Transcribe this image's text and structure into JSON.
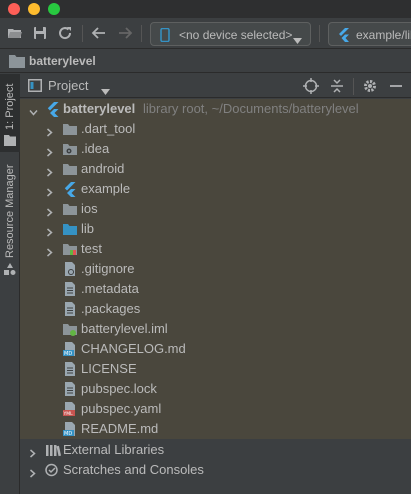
{
  "toolbar": {
    "device_selector": "<no device selected>",
    "config_selector": "example/lib"
  },
  "breadcrumb": {
    "label": "batterylevel"
  },
  "side_strip": {
    "project_tab": "1: Project",
    "resource_tab": "Resource Manager"
  },
  "panel": {
    "title": "Project"
  },
  "tree": {
    "root": {
      "name": "batterylevel",
      "hint": "library root, ~/Documents/batterylevel"
    },
    "items": [
      {
        "label": ".dart_tool",
        "icon": "folder-icon"
      },
      {
        "label": ".idea",
        "icon": "folder-settings-icon"
      },
      {
        "label": "android",
        "icon": "folder-icon"
      },
      {
        "label": "example",
        "icon": "flutter-icon"
      },
      {
        "label": "ios",
        "icon": "folder-icon"
      },
      {
        "label": "lib",
        "icon": "source-folder-icon"
      },
      {
        "label": "test",
        "icon": "test-folder-icon"
      },
      {
        "label": ".gitignore",
        "icon": "gitignore-file-icon"
      },
      {
        "label": ".metadata",
        "icon": "text-file-icon"
      },
      {
        "label": ".packages",
        "icon": "text-file-icon"
      },
      {
        "label": "batterylevel.iml",
        "icon": "iml-file-icon"
      },
      {
        "label": "CHANGELOG.md",
        "icon": "markdown-file-icon"
      },
      {
        "label": "LICENSE",
        "icon": "text-file-icon"
      },
      {
        "label": "pubspec.lock",
        "icon": "text-file-icon"
      },
      {
        "label": "pubspec.yaml",
        "icon": "yaml-file-icon"
      },
      {
        "label": "README.md",
        "icon": "markdown-file-icon"
      }
    ],
    "external_libraries": "External Libraries",
    "scratches": "Scratches and Consoles"
  },
  "colors": {
    "background": "#3c3f41",
    "tree_highlight": "#4a473d",
    "folder": "#8c9499",
    "flutter_blue": "#47a8e8",
    "accent_blue": "#3592c4"
  }
}
